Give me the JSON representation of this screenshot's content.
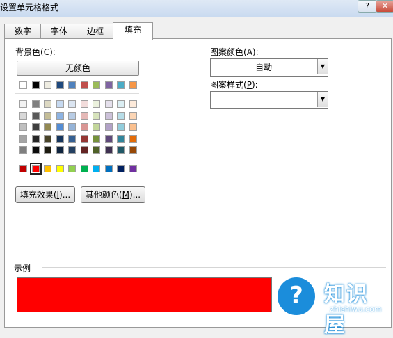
{
  "window": {
    "title": "设置单元格格式",
    "help_label": "?",
    "close_label": "✕"
  },
  "tabs": [
    {
      "label": "数字"
    },
    {
      "label": "字体"
    },
    {
      "label": "边框"
    },
    {
      "label": "填充"
    }
  ],
  "fill": {
    "background_label_pre": "背景色(",
    "background_label_key": "C",
    "background_label_post": "):",
    "no_color_label": "无颜色",
    "fill_effects_pre": "填充效果(",
    "fill_effects_key": "I",
    "fill_effects_post": ")...",
    "more_colors_pre": "其他颜色(",
    "more_colors_key": "M",
    "more_colors_post": ")...",
    "pattern_color_pre": "图案颜色(",
    "pattern_color_key": "A",
    "pattern_color_post": "):",
    "pattern_color_value": "自动",
    "pattern_style_pre": "图案样式(",
    "pattern_style_key": "P",
    "pattern_style_post": "):",
    "pattern_style_value": "",
    "sample_label": "示例",
    "sample_color": "#ff0000",
    "selected_color": "#ff0000",
    "palette_theme_row": [
      "#ffffff",
      "#000000",
      "#eeece1",
      "#1f497d",
      "#4f81bd",
      "#c0504d",
      "#9bbb59",
      "#8064a2",
      "#4bacc6",
      "#f79646"
    ],
    "palette_tints": [
      [
        "#f2f2f2",
        "#7f7f7f",
        "#ddd9c3",
        "#c6d9f0",
        "#dbe5f1",
        "#f2dcdb",
        "#ebf1dd",
        "#e5e0ec",
        "#dbeef3",
        "#fdeada"
      ],
      [
        "#d8d8d8",
        "#595959",
        "#c4bd97",
        "#8db3e2",
        "#b8cce4",
        "#e5b9b7",
        "#d7e3bc",
        "#ccc1d9",
        "#b7dde8",
        "#fbd5b5"
      ],
      [
        "#bfbfbf",
        "#3f3f3f",
        "#938953",
        "#548dd4",
        "#95b3d7",
        "#d99694",
        "#c3d69b",
        "#b2a2c7",
        "#92cddc",
        "#fac08f"
      ],
      [
        "#a5a5a5",
        "#262626",
        "#494429",
        "#17365d",
        "#366092",
        "#953734",
        "#76923c",
        "#5f497a",
        "#31859b",
        "#e36c09"
      ],
      [
        "#7f7f7f",
        "#0c0c0c",
        "#1d1b10",
        "#0f243e",
        "#244061",
        "#632423",
        "#4f6128",
        "#3f3151",
        "#205867",
        "#974806"
      ]
    ],
    "palette_standard": [
      "#c00000",
      "#ff0000",
      "#ffc000",
      "#ffff00",
      "#92d050",
      "#00b050",
      "#00b0f0",
      "#0070c0",
      "#002060",
      "#7030a0"
    ],
    "selected_standard_index": 1
  },
  "watermark": {
    "logo_symbol": "?",
    "name_cn": "知识屋",
    "name_en": "zhishiwu.com"
  }
}
